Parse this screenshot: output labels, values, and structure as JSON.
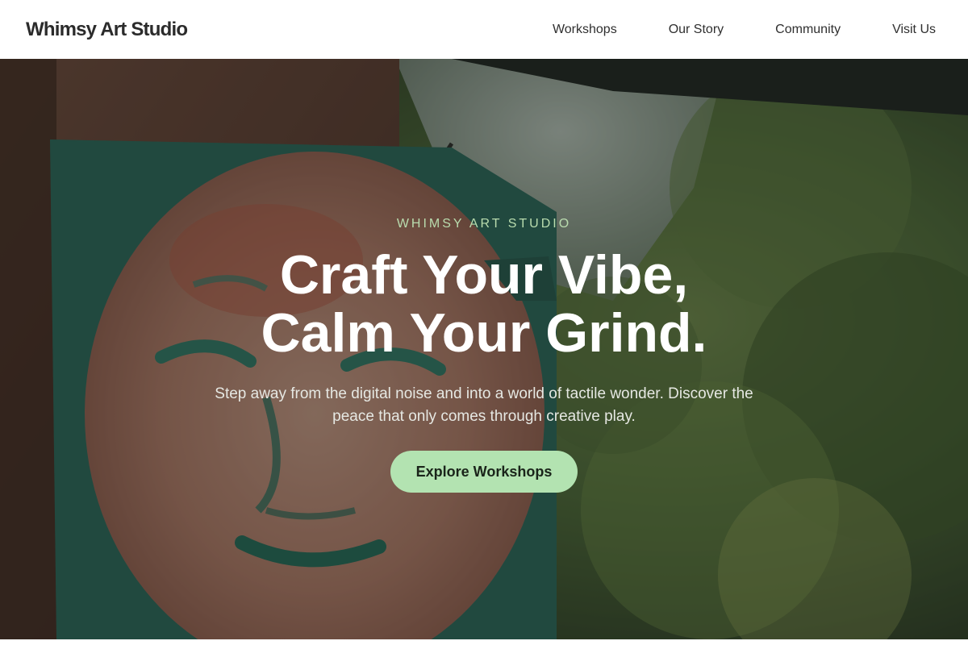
{
  "header": {
    "logo": "Whimsy Art Studio",
    "nav": [
      {
        "label": "Workshops"
      },
      {
        "label": "Our Story"
      },
      {
        "label": "Community"
      },
      {
        "label": "Visit Us"
      }
    ]
  },
  "hero": {
    "eyebrow": "WHIMSY ART STUDIO",
    "headline_line1": "Craft Your Vibe,",
    "headline_line2": "Calm Your Grind.",
    "subtext": "Step away from the digital noise and into a world of tactile wonder. Discover the peace that only comes through creative play.",
    "cta_label": "Explore Workshops"
  },
  "colors": {
    "accent": "#b3e3b1",
    "eyebrow": "#b9dcae",
    "header_bg": "#ffffff"
  }
}
